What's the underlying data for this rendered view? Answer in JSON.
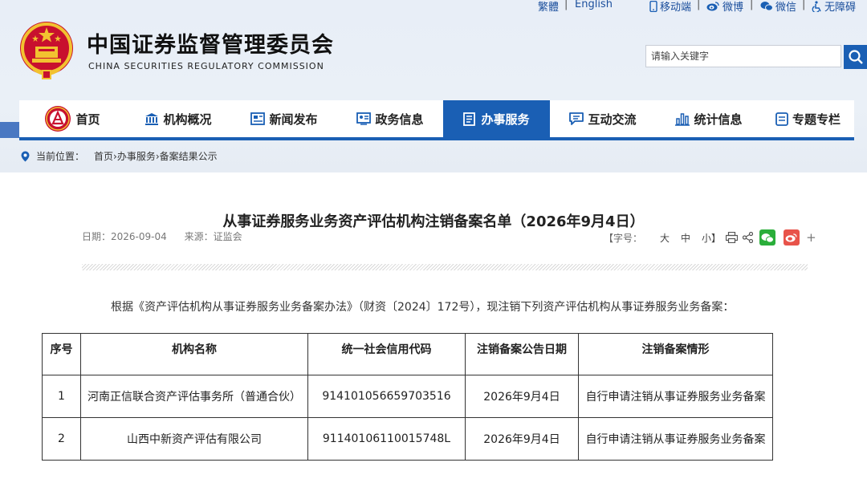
{
  "topbar": {
    "traditional": "繁體",
    "english": "English",
    "mobile": "移动端",
    "weibo": "微博",
    "wechat": "微信",
    "accessibility": "无障碍"
  },
  "header": {
    "title_cn": "中国证券监督管理委员会",
    "title_en": "CHINA SECURITIES REGULATORY COMMISSION",
    "search_placeholder": "请输入关键字"
  },
  "nav": {
    "items": [
      {
        "label": "首页",
        "icon": "emblem-icon"
      },
      {
        "label": "机构概况",
        "icon": "institution-icon"
      },
      {
        "label": "新闻发布",
        "icon": "news-icon"
      },
      {
        "label": "政务信息",
        "icon": "info-icon"
      },
      {
        "label": "办事服务",
        "icon": "service-icon",
        "active": true
      },
      {
        "label": "互动交流",
        "icon": "chat-icon"
      },
      {
        "label": "统计信息",
        "icon": "stats-icon"
      },
      {
        "label": "专题专栏",
        "icon": "topic-icon"
      }
    ]
  },
  "breadcrumb": {
    "label": "当前位置：",
    "path": "首页›办事服务›备案结果公示"
  },
  "article": {
    "title": "从事证券服务业务资产评估机构注销备案名单（2026年9月4日）",
    "date": "日期：2026-09-04",
    "source": "来源：证监会",
    "font_label": "【字号：",
    "font_large": "大",
    "font_medium": "中",
    "font_small": "小】",
    "body": "根据《资产评估机构从事证券服务业务备案办法》（财资〔2024〕172号），现注销下列资产评估机构从事证券服务业务备案："
  },
  "table": {
    "headers": [
      "序号",
      "机构名称",
      "统一社会信用代码",
      "注销备案公告日期",
      "注销备案情形"
    ],
    "rows": [
      [
        "1",
        "河南正信联合资产评估事务所（普通合伙）",
        "914101056659703516",
        "2026年9月4日",
        "自行申请注销从事证券服务业务备案"
      ],
      [
        "2",
        "山西中新资产评估有限公司",
        "91140106110015748L",
        "2026年9月4日",
        "自行申请注销从事证券服务业务备案"
      ]
    ]
  },
  "colors": {
    "brand_blue": "#1a5fb4",
    "header_bg": "#e8eef7",
    "wechat_green": "#2aae3a",
    "weibo_red": "#e8534a"
  }
}
